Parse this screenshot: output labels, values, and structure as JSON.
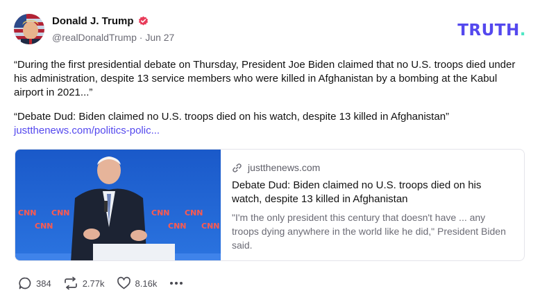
{
  "post": {
    "author_name": "Donald J. Trump",
    "handle": "@realDonaldTrump",
    "separator": "·",
    "date": "Jun 27",
    "text": "“During the first presidential debate on Thursday, President Joe Biden claimed that no U.S. troops died under his administration, despite 13 service members who were killed in Afghanistan by a bombing at the Kabul airport in 2021...”",
    "quote": "“Debate Dud: Biden claimed no U.S. troops died on his watch, despite 13 killed in Afghanistan”",
    "link_text": "justthenews.com/politics-polic..."
  },
  "brand": {
    "wordmark": "TRUTH",
    "dot": ".",
    "color": "#5448ee",
    "dot_color": "#4ee7c4"
  },
  "card": {
    "domain": "justthenews.com",
    "title": "Debate Dud: Biden claimed no U.S. troops died on his watch, despite 13 killed in Afghanistan",
    "description": "\"I'm the only president this century that doesn't have ... any troops dying anywhere in the world like he did,\" President Biden said.",
    "image_logo_text": "CNN"
  },
  "actions": {
    "replies": "384",
    "retruths": "2.77k",
    "likes": "8.16k"
  },
  "icons": {
    "verified": "verified-badge-icon",
    "link": "link-icon",
    "reply": "reply-bubble-icon",
    "retruth": "retruth-arrows-icon",
    "like": "heart-icon",
    "more": "more-dots-icon"
  },
  "colors": {
    "accent": "#5448ee",
    "verified": "#e83c5a",
    "muted_text": "#6b6b75"
  }
}
